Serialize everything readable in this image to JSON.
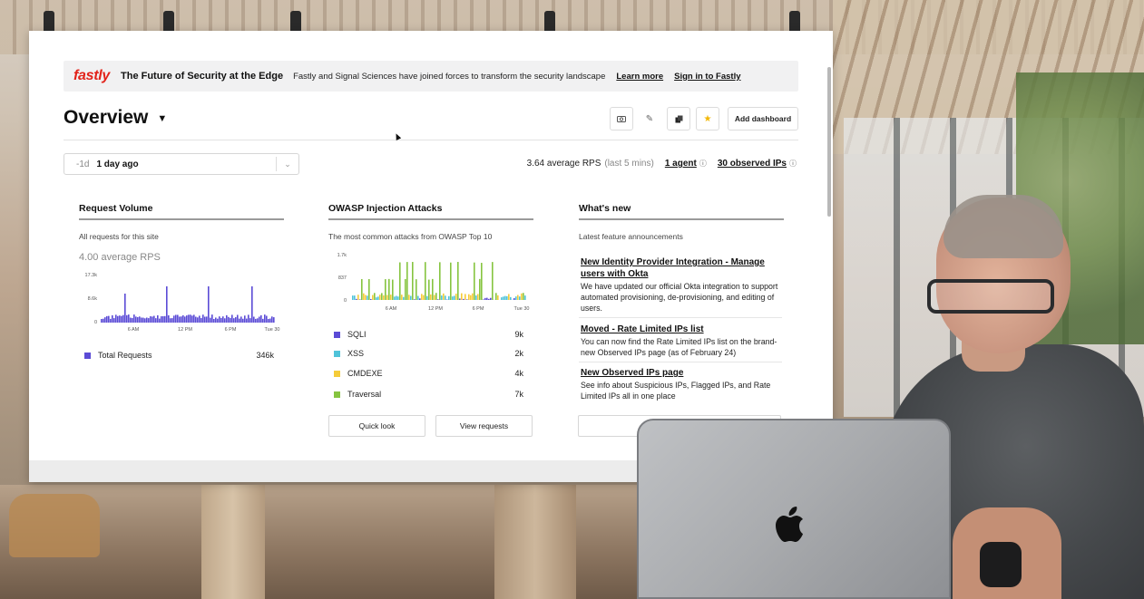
{
  "banner": {
    "logo": "fastly",
    "title": "The Future of Security at the Edge",
    "description": "Fastly and Signal Sciences have joined forces to transform the security landscape",
    "learn_more": "Learn more",
    "sign_in": "Sign in to Fastly"
  },
  "header": {
    "title": "Overview",
    "add_dashboard": "Add dashboard",
    "icons": [
      "camera-icon",
      "pencil-icon",
      "copy-icon",
      "star-icon"
    ]
  },
  "time_picker": {
    "short": "-1d",
    "label": "1 day ago"
  },
  "stats": {
    "rps": "3.64 average RPS",
    "rps_note": "(last 5 mins)",
    "agents": "1 agent",
    "observed_ips": "30 observed IPs"
  },
  "request_volume": {
    "title": "Request Volume",
    "subtitle": "All requests for this site",
    "average": "4.00 average RPS",
    "y_ticks": [
      "17.3k",
      "8.6k",
      "0"
    ],
    "x_ticks": [
      "6 AM",
      "12 PM",
      "6 PM",
      "Tue 30"
    ],
    "legend": {
      "label": "Total Requests",
      "value": "346k"
    },
    "color": "#5b4bd6"
  },
  "owasp": {
    "title": "OWASP Injection Attacks",
    "subtitle": "The most common attacks from OWASP Top 10",
    "y_ticks": [
      "1.7k",
      "837",
      "0"
    ],
    "x_ticks": [
      "6 AM",
      "12 PM",
      "6 PM",
      "Tue 30"
    ],
    "legend": [
      {
        "label": "SQLI",
        "value": "9k",
        "color": "#5b4bd6"
      },
      {
        "label": "XSS",
        "value": "2k",
        "color": "#4fc3d9"
      },
      {
        "label": "CMDEXE",
        "value": "4k",
        "color": "#f5cc3a"
      },
      {
        "label": "Traversal",
        "value": "7k",
        "color": "#86c440"
      }
    ],
    "quick_look": "Quick look",
    "view_requests": "View requests"
  },
  "whats_new": {
    "title": "What's new",
    "subtitle": "Latest feature announcements",
    "items": [
      {
        "title": "New Identity Provider Integration - Manage users with Okta",
        "body": "We have updated our official Okta integration to support automated provisioning, de-provisioning, and editing of users."
      },
      {
        "title": "Moved - Rate Limited IPs list",
        "body": "You can now find the Rate Limited IPs list on the brand-new Observed IPs page (as of February 24)"
      },
      {
        "title": "New Observed IPs page",
        "body": "See info about Suspicious IPs, Flagged IPs, and Rate Limited IPs all in one place"
      }
    ]
  }
}
